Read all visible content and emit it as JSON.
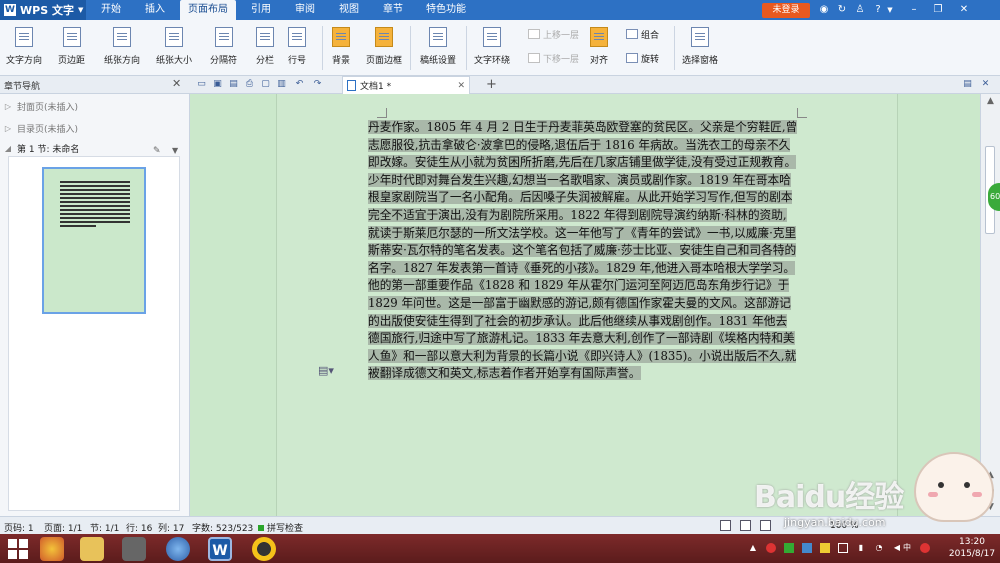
{
  "app": {
    "name": "WPS 文字",
    "login_label": "未登录"
  },
  "menu_tabs": [
    "开始",
    "插入",
    "页面布局",
    "引用",
    "审阅",
    "视图",
    "章节",
    "特色功能"
  ],
  "menu_active": "页面布局",
  "title_icons": [
    "skin-icon",
    "shirt-icon",
    "settings-icon",
    "help-icon",
    "minimize-icon",
    "restore-icon",
    "close-icon"
  ],
  "title_help": "?",
  "ribbon": {
    "large": [
      "文字方向",
      "页边距",
      "纸张方向",
      "纸张大小",
      "分隔符",
      "分栏",
      "行号",
      "背景",
      "页面边框",
      "稿纸设置",
      "文字环绕",
      "对齐",
      "旋转",
      "选择窗格"
    ],
    "small": {
      "up": "上移一层",
      "down": "下移一层",
      "group": "组合"
    }
  },
  "navpanel": {
    "title": "章节导航",
    "items": [
      "封面页(未插入)",
      "目录页(未插入)",
      "第 1 节: 未命名"
    ]
  },
  "doc_tab": {
    "label": "文档1 *"
  },
  "document": {
    "paragraph": "丹麦作家。1805 年 4 月 2 日生于丹麦菲英岛欧登塞的贫民区。父亲是个穷鞋匠,曾志愿服役,抗击拿破仑·波拿巴的侵略,退伍后于 1816 年病故。当洗衣工的母亲不久即改嫁。安徒生从小就为贫困所折磨,先后在几家店铺里做学徒,没有受过正规教育。少年时代即对舞台发生兴趣,幻想当一名歌唱家、演员或剧作家。1819 年在哥本哈根皇家剧院当了一名小配角。后因嗓子失润被解雇。从此开始学习写作,但写的剧本完全不适宜于演出,没有为剧院所采用。1822 年得到剧院导演约纳斯·科林的资助,就读于斯莱厄尔瑟的一所文法学校。这一年他写了《青年的尝试》一书,以威廉·克里斯蒂安·瓦尔特的笔名发表。这个笔名包括了威廉·莎士比亚、安徒生自己和司各特的名字。1827 年发表第一首诗《垂死的小孩》。1829 年,他进入哥本哈根大学学习。他的第一部重要作品《1828 和 1829 年从霍尔门运河至阿迈厄岛东角步行记》于 1829 年问世。这是一部富于幽默感的游记,颇有德国作家霍夫曼的文风。这部游记的出版使安徒生得到了社会的初步承认。此后他继续从事戏剧创作。1831 年他去德国旅行,归途中写了旅游札记。1833 年去意大利,创作了一部诗剧《埃格内特和美人鱼》和一部以意大利为背景的长篇小说《即兴诗人》(1835)。小说出版后不久,就被翻译成德文和英文,标志着作者开始享有国际声誉。"
  },
  "side_badge": "60",
  "status": {
    "page_code": "页码: 1",
    "pages": "页面: 1/1",
    "section": "节: 1/1",
    "row": "行: 16",
    "col": "列: 17",
    "words": "字数: 523/523",
    "spell": "拼写检查",
    "zoom": "100 %"
  },
  "taskbar": {
    "time": "13:20",
    "date": "2015/8/17",
    "ime": "中"
  },
  "watermark": {
    "brand": "Baidu经验",
    "url": "jingyan.baidu.com"
  }
}
